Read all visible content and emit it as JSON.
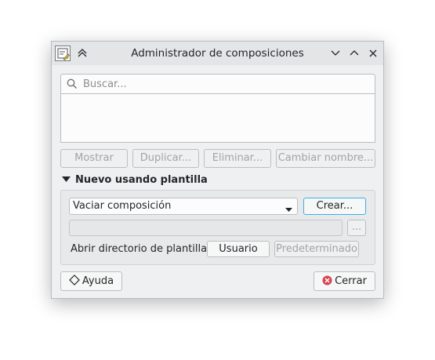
{
  "window": {
    "title": "Administrador de composiciones",
    "controls": [
      "chevron-down",
      "chevron-up",
      "close"
    ]
  },
  "search": {
    "placeholder": "Buscar..."
  },
  "actions": {
    "show": "Mostrar",
    "duplicate": "Duplicar...",
    "delete": "Eliminar...",
    "rename": "Cambiar nombre..."
  },
  "new_from_template": {
    "header": "Nuevo usando plantilla",
    "template_selected": "Vaciar composición",
    "create": "Crear...",
    "browse": "...",
    "open_dir_label": "Abrir directorio de plantillas",
    "user": "Usuario",
    "default": "Predeterminado"
  },
  "footer": {
    "help": "Ayuda",
    "close": "Cerrar"
  },
  "colors": {
    "accent": "#3daee9",
    "close_icon": "#da4453"
  }
}
